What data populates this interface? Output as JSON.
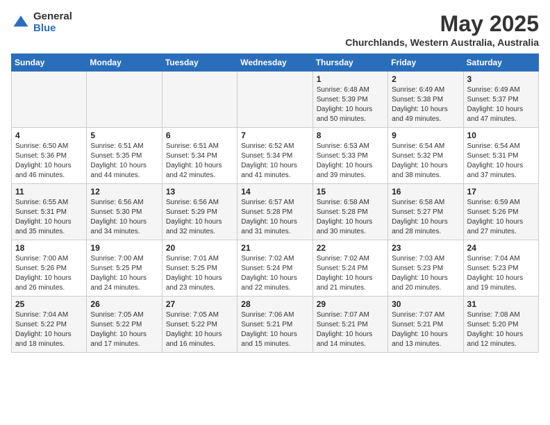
{
  "header": {
    "logo_general": "General",
    "logo_blue": "Blue",
    "title": "May 2025",
    "subtitle": "Churchlands, Western Australia, Australia"
  },
  "weekdays": [
    "Sunday",
    "Monday",
    "Tuesday",
    "Wednesday",
    "Thursday",
    "Friday",
    "Saturday"
  ],
  "weeks": [
    [
      {
        "day": "",
        "info": ""
      },
      {
        "day": "",
        "info": ""
      },
      {
        "day": "",
        "info": ""
      },
      {
        "day": "",
        "info": ""
      },
      {
        "day": "1",
        "info": "Sunrise: 6:48 AM\nSunset: 5:39 PM\nDaylight: 10 hours\nand 50 minutes."
      },
      {
        "day": "2",
        "info": "Sunrise: 6:49 AM\nSunset: 5:38 PM\nDaylight: 10 hours\nand 49 minutes."
      },
      {
        "day": "3",
        "info": "Sunrise: 6:49 AM\nSunset: 5:37 PM\nDaylight: 10 hours\nand 47 minutes."
      }
    ],
    [
      {
        "day": "4",
        "info": "Sunrise: 6:50 AM\nSunset: 5:36 PM\nDaylight: 10 hours\nand 46 minutes."
      },
      {
        "day": "5",
        "info": "Sunrise: 6:51 AM\nSunset: 5:35 PM\nDaylight: 10 hours\nand 44 minutes."
      },
      {
        "day": "6",
        "info": "Sunrise: 6:51 AM\nSunset: 5:34 PM\nDaylight: 10 hours\nand 42 minutes."
      },
      {
        "day": "7",
        "info": "Sunrise: 6:52 AM\nSunset: 5:34 PM\nDaylight: 10 hours\nand 41 minutes."
      },
      {
        "day": "8",
        "info": "Sunrise: 6:53 AM\nSunset: 5:33 PM\nDaylight: 10 hours\nand 39 minutes."
      },
      {
        "day": "9",
        "info": "Sunrise: 6:54 AM\nSunset: 5:32 PM\nDaylight: 10 hours\nand 38 minutes."
      },
      {
        "day": "10",
        "info": "Sunrise: 6:54 AM\nSunset: 5:31 PM\nDaylight: 10 hours\nand 37 minutes."
      }
    ],
    [
      {
        "day": "11",
        "info": "Sunrise: 6:55 AM\nSunset: 5:31 PM\nDaylight: 10 hours\nand 35 minutes."
      },
      {
        "day": "12",
        "info": "Sunrise: 6:56 AM\nSunset: 5:30 PM\nDaylight: 10 hours\nand 34 minutes."
      },
      {
        "day": "13",
        "info": "Sunrise: 6:56 AM\nSunset: 5:29 PM\nDaylight: 10 hours\nand 32 minutes."
      },
      {
        "day": "14",
        "info": "Sunrise: 6:57 AM\nSunset: 5:28 PM\nDaylight: 10 hours\nand 31 minutes."
      },
      {
        "day": "15",
        "info": "Sunrise: 6:58 AM\nSunset: 5:28 PM\nDaylight: 10 hours\nand 30 minutes."
      },
      {
        "day": "16",
        "info": "Sunrise: 6:58 AM\nSunset: 5:27 PM\nDaylight: 10 hours\nand 28 minutes."
      },
      {
        "day": "17",
        "info": "Sunrise: 6:59 AM\nSunset: 5:26 PM\nDaylight: 10 hours\nand 27 minutes."
      }
    ],
    [
      {
        "day": "18",
        "info": "Sunrise: 7:00 AM\nSunset: 5:26 PM\nDaylight: 10 hours\nand 26 minutes."
      },
      {
        "day": "19",
        "info": "Sunrise: 7:00 AM\nSunset: 5:25 PM\nDaylight: 10 hours\nand 24 minutes."
      },
      {
        "day": "20",
        "info": "Sunrise: 7:01 AM\nSunset: 5:25 PM\nDaylight: 10 hours\nand 23 minutes."
      },
      {
        "day": "21",
        "info": "Sunrise: 7:02 AM\nSunset: 5:24 PM\nDaylight: 10 hours\nand 22 minutes."
      },
      {
        "day": "22",
        "info": "Sunrise: 7:02 AM\nSunset: 5:24 PM\nDaylight: 10 hours\nand 21 minutes."
      },
      {
        "day": "23",
        "info": "Sunrise: 7:03 AM\nSunset: 5:23 PM\nDaylight: 10 hours\nand 20 minutes."
      },
      {
        "day": "24",
        "info": "Sunrise: 7:04 AM\nSunset: 5:23 PM\nDaylight: 10 hours\nand 19 minutes."
      }
    ],
    [
      {
        "day": "25",
        "info": "Sunrise: 7:04 AM\nSunset: 5:22 PM\nDaylight: 10 hours\nand 18 minutes."
      },
      {
        "day": "26",
        "info": "Sunrise: 7:05 AM\nSunset: 5:22 PM\nDaylight: 10 hours\nand 17 minutes."
      },
      {
        "day": "27",
        "info": "Sunrise: 7:05 AM\nSunset: 5:22 PM\nDaylight: 10 hours\nand 16 minutes."
      },
      {
        "day": "28",
        "info": "Sunrise: 7:06 AM\nSunset: 5:21 PM\nDaylight: 10 hours\nand 15 minutes."
      },
      {
        "day": "29",
        "info": "Sunrise: 7:07 AM\nSunset: 5:21 PM\nDaylight: 10 hours\nand 14 minutes."
      },
      {
        "day": "30",
        "info": "Sunrise: 7:07 AM\nSunset: 5:21 PM\nDaylight: 10 hours\nand 13 minutes."
      },
      {
        "day": "31",
        "info": "Sunrise: 7:08 AM\nSunset: 5:20 PM\nDaylight: 10 hours\nand 12 minutes."
      }
    ]
  ]
}
